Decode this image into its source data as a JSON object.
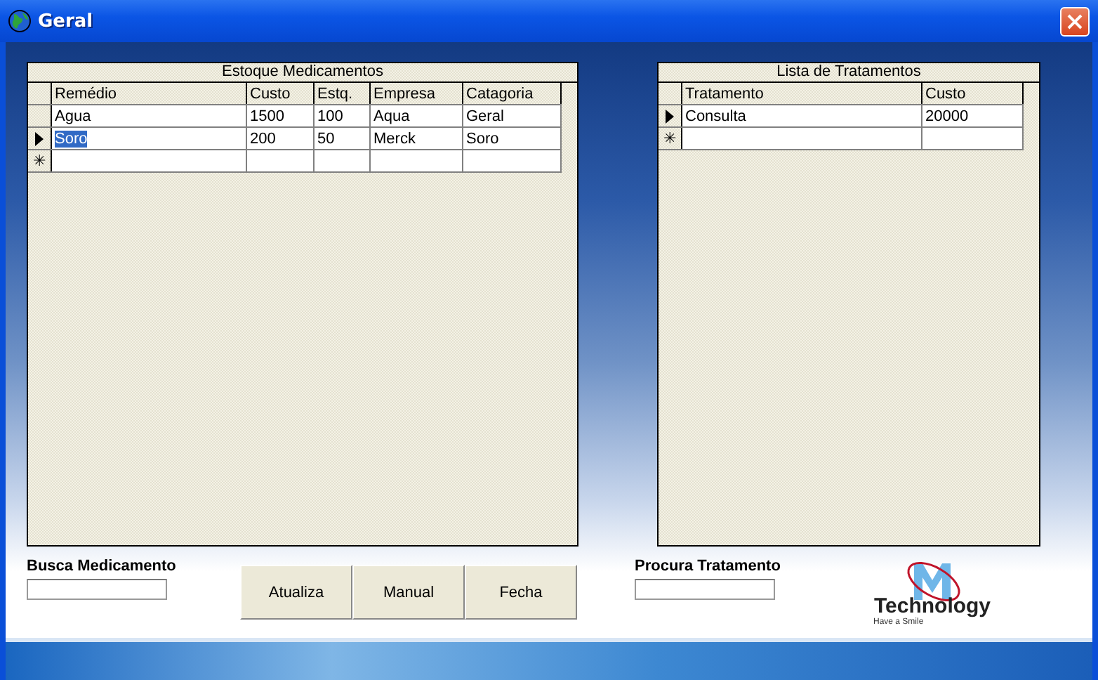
{
  "window": {
    "title": "Geral"
  },
  "grids": [
    {
      "title": "Estoque Medicamentos",
      "columns": [
        "Remédio",
        "Custo",
        "Estq.",
        "Empresa",
        "Catagoria"
      ],
      "rows": [
        {
          "selected": false,
          "cells": [
            "Agua",
            "1500",
            "100",
            "Aqua",
            "Geral"
          ]
        },
        {
          "selected": true,
          "cells": [
            "Soro",
            "200",
            "50",
            "Merck",
            "Soro"
          ]
        }
      ],
      "new_row_marker": "✳"
    },
    {
      "title": "Lista de Tratamentos",
      "columns": [
        "Tratamento",
        "Custo"
      ],
      "rows": [
        {
          "selected": true,
          "cells": [
            "Consulta",
            "20000"
          ]
        }
      ],
      "new_row_marker": "✳"
    }
  ],
  "search_fields": [
    {
      "label": "Busca Medicamento"
    },
    {
      "label": "Procura Tratamento"
    }
  ],
  "buttons": [
    "Atualiza",
    "Manual",
    "Fecha"
  ],
  "logo": {
    "name": "Technology",
    "tagline": "Have a Smile"
  }
}
